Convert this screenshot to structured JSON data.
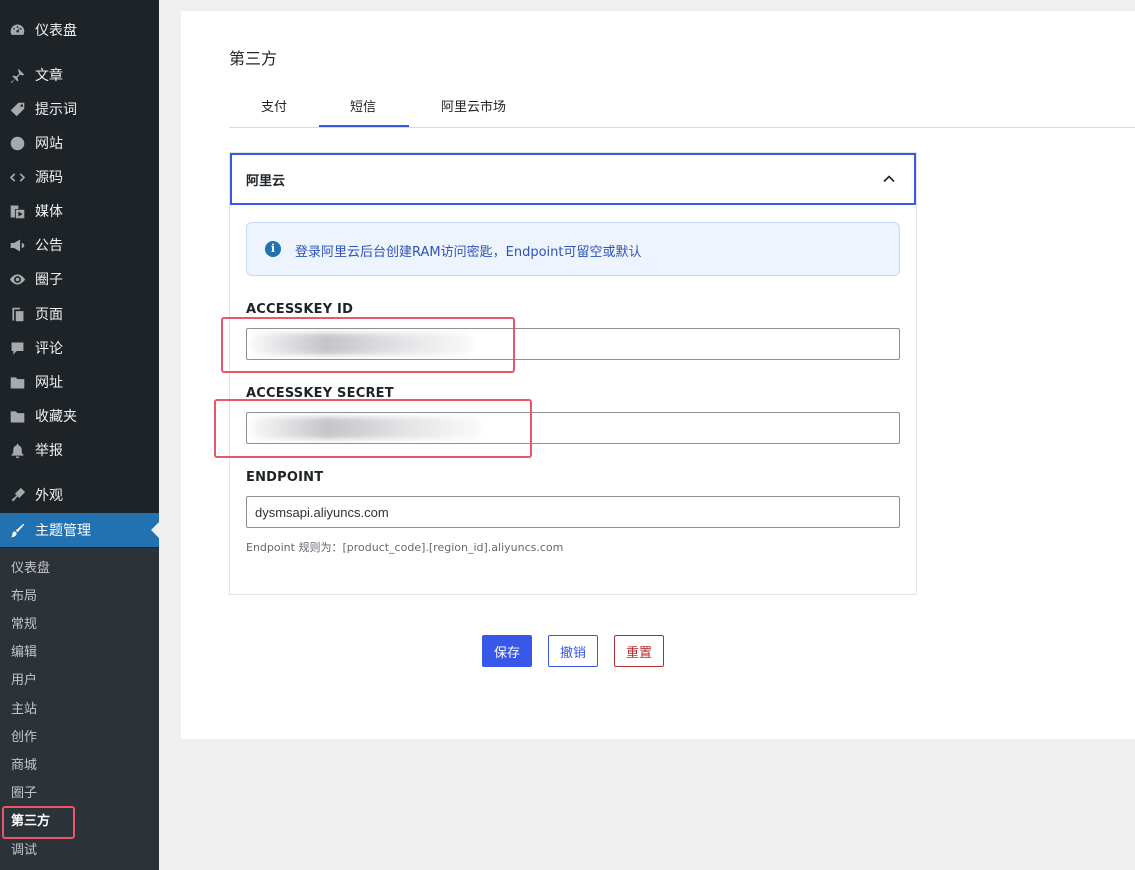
{
  "sidebar": {
    "items": [
      {
        "label": "仪表盘",
        "icon": "dashboard-icon"
      },
      {
        "label": "文章",
        "icon": "pin-icon"
      },
      {
        "label": "提示词",
        "icon": "tag-icon"
      },
      {
        "label": "网站",
        "icon": "globe-icon"
      },
      {
        "label": "源码",
        "icon": "code-icon"
      },
      {
        "label": "媒体",
        "icon": "media-icon"
      },
      {
        "label": "公告",
        "icon": "megaphone-icon"
      },
      {
        "label": "圈子",
        "icon": "eye-icon"
      },
      {
        "label": "页面",
        "icon": "pages-icon"
      },
      {
        "label": "评论",
        "icon": "comment-icon"
      },
      {
        "label": "网址",
        "icon": "folder-icon"
      },
      {
        "label": "收藏夹",
        "icon": "folder-icon"
      },
      {
        "label": "举报",
        "icon": "bell-icon"
      },
      {
        "label": "外观",
        "icon": "brush-icon"
      },
      {
        "label": "主题管理",
        "icon": "brush-icon"
      }
    ],
    "submenu": [
      "仪表盘",
      "布局",
      "常规",
      "编辑",
      "用户",
      "主站",
      "创作",
      "商城",
      "圈子",
      "第三方",
      "调试"
    ]
  },
  "page": {
    "title": "第三方",
    "tabs": [
      "支付",
      "短信",
      "阿里云市场"
    ],
    "active_tab": "短信"
  },
  "accordion": {
    "title": "阿里云"
  },
  "notice": {
    "text": "登录阿里云后台创建RAM访问密匙，Endpoint可留空或默认"
  },
  "fields": {
    "accesskey_id": {
      "label": "ACCESSKEY ID",
      "value": ""
    },
    "accesskey_secret": {
      "label": "ACCESSKEY SECRET",
      "value": ""
    },
    "endpoint": {
      "label": "ENDPOINT",
      "value": "dysmsapi.aliyuncs.com",
      "help": "Endpoint 规则为：[product_code].[region_id].aliyuncs.com"
    }
  },
  "buttons": {
    "save": "保存",
    "cancel": "撤销",
    "reset": "重置"
  },
  "colors": {
    "accent": "#3858e9",
    "sidebar_bg": "#1d2327",
    "menu_active": "#2271b1",
    "highlight_box": "#ec5565",
    "danger": "#b32d2e"
  }
}
